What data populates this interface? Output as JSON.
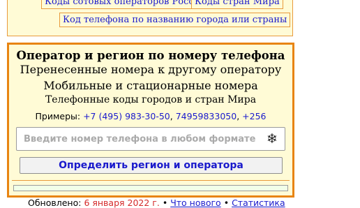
{
  "top_links": {
    "operators_russia": "Коды сотовых операторов России",
    "country_codes": "Коды стран Мира",
    "city_country_lookup": "Код телефона по названию города или страны"
  },
  "main": {
    "title": "Оператор и регион по номеру телефона",
    "subtitle1": "Перенесенные номера к другому оператору",
    "subtitle2": "Мобильные и стационарные номера",
    "subtitle3": "Телефонные коды городов и стран Мира",
    "examples_label": "Примеры:",
    "examples": [
      "+7 (495) 983-30-50",
      "74959833050",
      "+256"
    ],
    "examples_sep": ", ",
    "search_placeholder": "Введите номер телефона в любом формате",
    "snowflake_icon": "❄",
    "submit_label": "Определить регион и оператора"
  },
  "footer": {
    "updated_label": "Обновлено:",
    "updated_date": "6 января 2022 г.",
    "whats_new": "Что нового",
    "stats": "Статистика"
  },
  "colors": {
    "panel_bg": "#fffbd6",
    "panel_border": "#e88412",
    "link": "#1a1acc",
    "date": "#d42a2a"
  }
}
